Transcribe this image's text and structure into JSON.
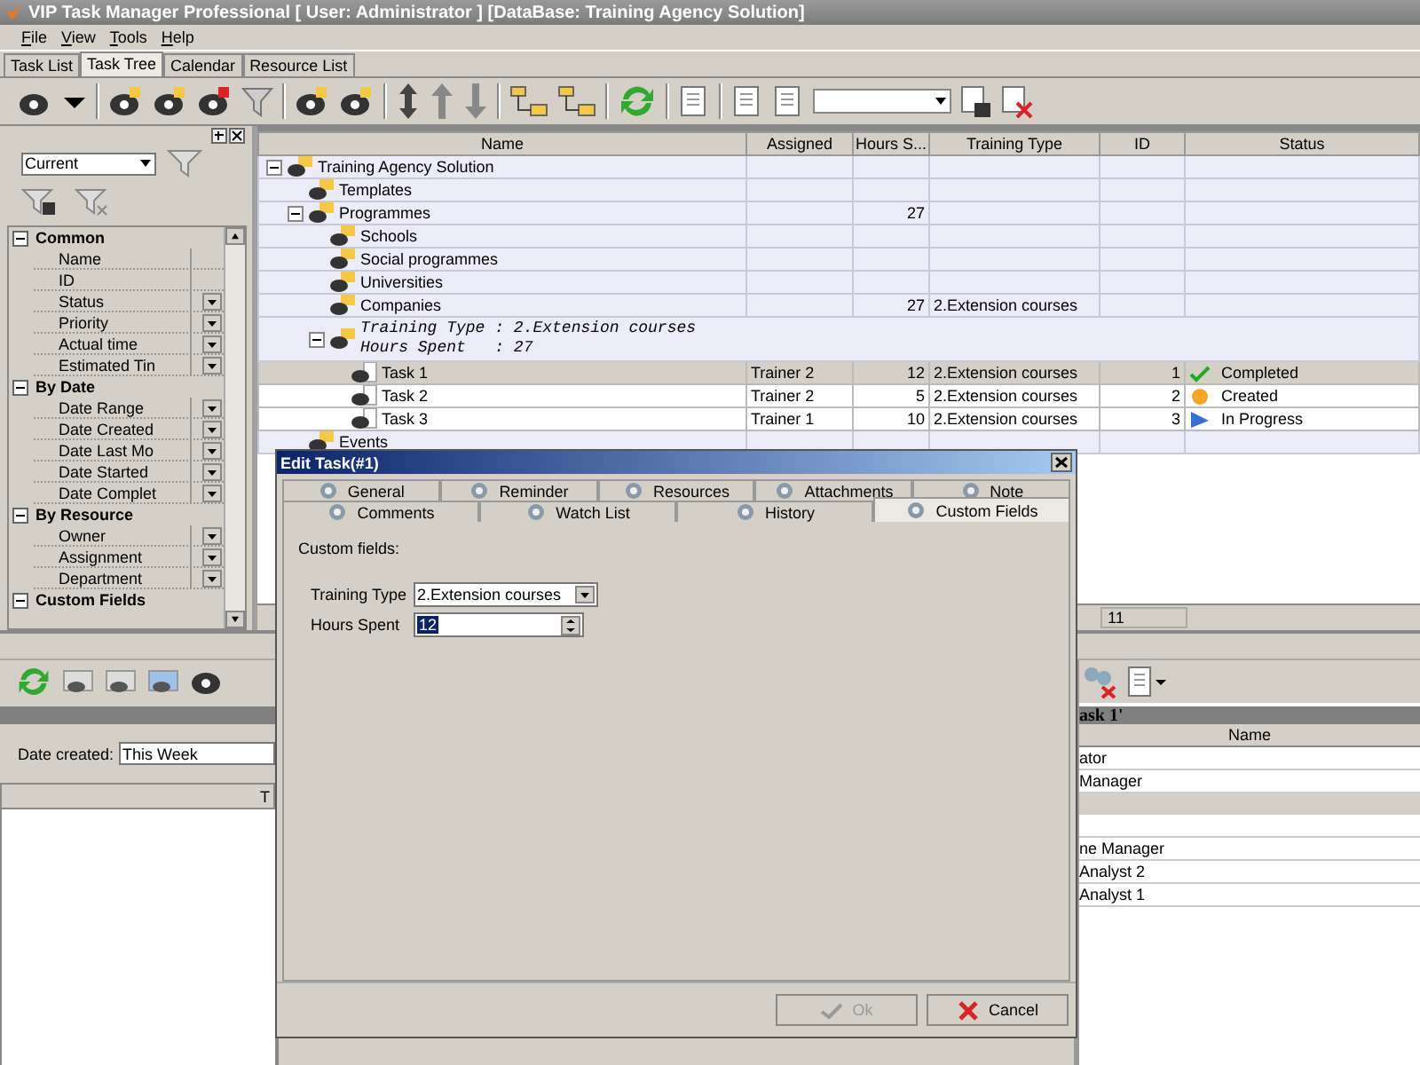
{
  "window": {
    "title": "VIP Task Manager Professional [ User: Administrator ] [DataBase: Training Agency Solution]"
  },
  "menu": [
    "File",
    "View",
    "Tools",
    "Help"
  ],
  "tabs": [
    {
      "label": "Task List",
      "selected": false
    },
    {
      "label": "Task Tree",
      "selected": true
    },
    {
      "label": "Calendar",
      "selected": false
    },
    {
      "label": "Resource List",
      "selected": false
    }
  ],
  "filter_panel": {
    "view": "Current",
    "categories": [
      {
        "label": "Common",
        "expanded": true,
        "items": [
          {
            "label": "Name",
            "dropdown": false
          },
          {
            "label": "ID",
            "dropdown": false
          },
          {
            "label": "Status",
            "dropdown": true
          },
          {
            "label": "Priority",
            "dropdown": true
          },
          {
            "label": "Actual time",
            "dropdown": true
          },
          {
            "label": "Estimated Tin",
            "dropdown": true
          }
        ]
      },
      {
        "label": "By Date",
        "expanded": true,
        "items": [
          {
            "label": "Date Range",
            "dropdown": true
          },
          {
            "label": "Date Created",
            "dropdown": true
          },
          {
            "label": "Date Last Mo",
            "dropdown": true
          },
          {
            "label": "Date Started",
            "dropdown": true
          },
          {
            "label": "Date Complet",
            "dropdown": true
          }
        ]
      },
      {
        "label": "By Resource",
        "expanded": true,
        "items": [
          {
            "label": "Owner",
            "dropdown": true
          },
          {
            "label": "Assignment",
            "dropdown": true
          },
          {
            "label": "Department",
            "dropdown": true
          }
        ]
      },
      {
        "label": "Custom Fields",
        "expanded": true
      }
    ]
  },
  "grid": {
    "columns": [
      "Name",
      "Assigned",
      "Hours S...",
      "Training Type",
      "ID",
      "Status"
    ],
    "rows": [
      {
        "kind": "folder",
        "name": "Training Agency Solution",
        "expanded": true,
        "selected": false,
        "children": [
          {
            "kind": "folder",
            "name": "Templates",
            "selected": false
          },
          {
            "kind": "folder",
            "name": "Programmes",
            "hours": "27",
            "expanded": true,
            "selected": false,
            "children": [
              {
                "kind": "folder",
                "name": "Schools",
                "selected": false
              },
              {
                "kind": "folder",
                "name": "Social programmes",
                "selected": false
              },
              {
                "kind": "folder",
                "name": "Universities",
                "selected": false
              },
              {
                "kind": "folder",
                "name": "Companies",
                "hours": "27",
                "training_type": "2.Extension courses",
                "selected": false
              },
              {
                "kind": "group",
                "lines": [
                  "Training Type : 2.Extension courses",
                  "Hours Spent   : 27"
                ],
                "expanded": true,
                "selected": false,
                "children": [
                  {
                    "kind": "task",
                    "name": "Task 1",
                    "assigned": "Trainer 2",
                    "hours": "12",
                    "training_type": "2.Extension courses",
                    "id": "1",
                    "status": {
                      "kind": "completed",
                      "label": "Completed"
                    },
                    "selected": true
                  },
                  {
                    "kind": "task",
                    "name": "Task 2",
                    "assigned": "Trainer 2",
                    "hours": "5",
                    "training_type": "2.Extension courses",
                    "id": "2",
                    "status": {
                      "kind": "created",
                      "label": "Created"
                    },
                    "selected": false
                  },
                  {
                    "kind": "task",
                    "name": "Task 3",
                    "assigned": "Trainer 1",
                    "hours": "10",
                    "training_type": "2.Extension courses",
                    "id": "3",
                    "status": {
                      "kind": "progress",
                      "label": "In Progress"
                    },
                    "selected": false
                  }
                ]
              }
            ]
          },
          {
            "kind": "folder",
            "name": "Events",
            "selected": false
          }
        ]
      }
    ],
    "footer": {
      "id": "11"
    }
  },
  "bottom_left": {
    "date_label": "Date created:",
    "date_value": "This Week",
    "columns": [
      "T"
    ]
  },
  "bottom_right": {
    "title": "ask 1'",
    "columns": [
      "Name"
    ],
    "rows": [
      {
        "kind": "row",
        "text": "ator"
      },
      {
        "kind": "row",
        "text": "Manager"
      },
      {
        "kind": "group"
      },
      {
        "kind": "blank"
      },
      {
        "kind": "row",
        "text": "ne Manager"
      },
      {
        "kind": "row",
        "text": "Analyst 2"
      },
      {
        "kind": "row",
        "text": "Analyst 1"
      }
    ]
  },
  "dialog": {
    "title": "Edit Task(#1)",
    "tab_rows": [
      [
        {
          "label": "General",
          "selected": false
        },
        {
          "label": "Reminder",
          "selected": false
        },
        {
          "label": "Resources",
          "selected": false
        },
        {
          "label": "Attachments",
          "selected": false
        },
        {
          "label": "Note",
          "selected": false
        }
      ],
      [
        {
          "label": "Comments",
          "selected": false
        },
        {
          "label": "Watch List",
          "selected": false
        },
        {
          "label": "History",
          "selected": false
        },
        {
          "label": "Custom Fields",
          "selected": true
        }
      ]
    ],
    "section_label": "Custom fields:",
    "fields": [
      {
        "label": "Training Type",
        "kind": "combo",
        "value": "2.Extension courses"
      },
      {
        "label": "Hours Spent",
        "kind": "spin",
        "value": "12"
      }
    ],
    "buttons": [
      {
        "label": "Ok",
        "kind": "ok",
        "disabled": true
      },
      {
        "label": "Cancel",
        "kind": "cancel",
        "disabled": false
      }
    ]
  }
}
